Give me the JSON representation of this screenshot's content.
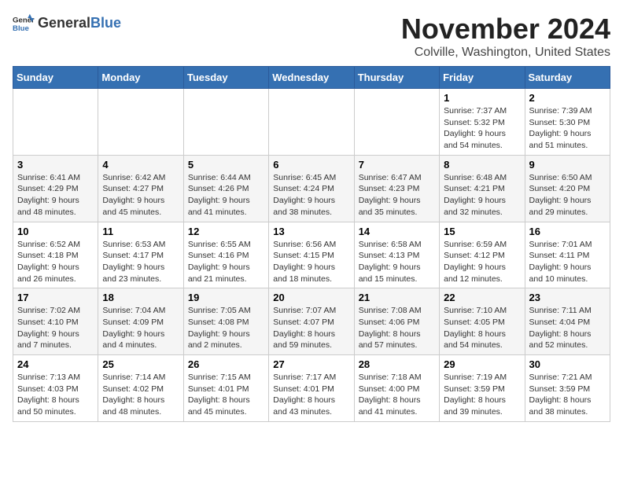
{
  "header": {
    "logo_general": "General",
    "logo_blue": "Blue",
    "month_title": "November 2024",
    "location": "Colville, Washington, United States"
  },
  "weekdays": [
    "Sunday",
    "Monday",
    "Tuesday",
    "Wednesday",
    "Thursday",
    "Friday",
    "Saturday"
  ],
  "weeks": [
    [
      {
        "day": "",
        "info": ""
      },
      {
        "day": "",
        "info": ""
      },
      {
        "day": "",
        "info": ""
      },
      {
        "day": "",
        "info": ""
      },
      {
        "day": "",
        "info": ""
      },
      {
        "day": "1",
        "info": "Sunrise: 7:37 AM\nSunset: 5:32 PM\nDaylight: 9 hours\nand 54 minutes."
      },
      {
        "day": "2",
        "info": "Sunrise: 7:39 AM\nSunset: 5:30 PM\nDaylight: 9 hours\nand 51 minutes."
      }
    ],
    [
      {
        "day": "3",
        "info": "Sunrise: 6:41 AM\nSunset: 4:29 PM\nDaylight: 9 hours\nand 48 minutes."
      },
      {
        "day": "4",
        "info": "Sunrise: 6:42 AM\nSunset: 4:27 PM\nDaylight: 9 hours\nand 45 minutes."
      },
      {
        "day": "5",
        "info": "Sunrise: 6:44 AM\nSunset: 4:26 PM\nDaylight: 9 hours\nand 41 minutes."
      },
      {
        "day": "6",
        "info": "Sunrise: 6:45 AM\nSunset: 4:24 PM\nDaylight: 9 hours\nand 38 minutes."
      },
      {
        "day": "7",
        "info": "Sunrise: 6:47 AM\nSunset: 4:23 PM\nDaylight: 9 hours\nand 35 minutes."
      },
      {
        "day": "8",
        "info": "Sunrise: 6:48 AM\nSunset: 4:21 PM\nDaylight: 9 hours\nand 32 minutes."
      },
      {
        "day": "9",
        "info": "Sunrise: 6:50 AM\nSunset: 4:20 PM\nDaylight: 9 hours\nand 29 minutes."
      }
    ],
    [
      {
        "day": "10",
        "info": "Sunrise: 6:52 AM\nSunset: 4:18 PM\nDaylight: 9 hours\nand 26 minutes."
      },
      {
        "day": "11",
        "info": "Sunrise: 6:53 AM\nSunset: 4:17 PM\nDaylight: 9 hours\nand 23 minutes."
      },
      {
        "day": "12",
        "info": "Sunrise: 6:55 AM\nSunset: 4:16 PM\nDaylight: 9 hours\nand 21 minutes."
      },
      {
        "day": "13",
        "info": "Sunrise: 6:56 AM\nSunset: 4:15 PM\nDaylight: 9 hours\nand 18 minutes."
      },
      {
        "day": "14",
        "info": "Sunrise: 6:58 AM\nSunset: 4:13 PM\nDaylight: 9 hours\nand 15 minutes."
      },
      {
        "day": "15",
        "info": "Sunrise: 6:59 AM\nSunset: 4:12 PM\nDaylight: 9 hours\nand 12 minutes."
      },
      {
        "day": "16",
        "info": "Sunrise: 7:01 AM\nSunset: 4:11 PM\nDaylight: 9 hours\nand 10 minutes."
      }
    ],
    [
      {
        "day": "17",
        "info": "Sunrise: 7:02 AM\nSunset: 4:10 PM\nDaylight: 9 hours\nand 7 minutes."
      },
      {
        "day": "18",
        "info": "Sunrise: 7:04 AM\nSunset: 4:09 PM\nDaylight: 9 hours\nand 4 minutes."
      },
      {
        "day": "19",
        "info": "Sunrise: 7:05 AM\nSunset: 4:08 PM\nDaylight: 9 hours\nand 2 minutes."
      },
      {
        "day": "20",
        "info": "Sunrise: 7:07 AM\nSunset: 4:07 PM\nDaylight: 8 hours\nand 59 minutes."
      },
      {
        "day": "21",
        "info": "Sunrise: 7:08 AM\nSunset: 4:06 PM\nDaylight: 8 hours\nand 57 minutes."
      },
      {
        "day": "22",
        "info": "Sunrise: 7:10 AM\nSunset: 4:05 PM\nDaylight: 8 hours\nand 54 minutes."
      },
      {
        "day": "23",
        "info": "Sunrise: 7:11 AM\nSunset: 4:04 PM\nDaylight: 8 hours\nand 52 minutes."
      }
    ],
    [
      {
        "day": "24",
        "info": "Sunrise: 7:13 AM\nSunset: 4:03 PM\nDaylight: 8 hours\nand 50 minutes."
      },
      {
        "day": "25",
        "info": "Sunrise: 7:14 AM\nSunset: 4:02 PM\nDaylight: 8 hours\nand 48 minutes."
      },
      {
        "day": "26",
        "info": "Sunrise: 7:15 AM\nSunset: 4:01 PM\nDaylight: 8 hours\nand 45 minutes."
      },
      {
        "day": "27",
        "info": "Sunrise: 7:17 AM\nSunset: 4:01 PM\nDaylight: 8 hours\nand 43 minutes."
      },
      {
        "day": "28",
        "info": "Sunrise: 7:18 AM\nSunset: 4:00 PM\nDaylight: 8 hours\nand 41 minutes."
      },
      {
        "day": "29",
        "info": "Sunrise: 7:19 AM\nSunset: 3:59 PM\nDaylight: 8 hours\nand 39 minutes."
      },
      {
        "day": "30",
        "info": "Sunrise: 7:21 AM\nSunset: 3:59 PM\nDaylight: 8 hours\nand 38 minutes."
      }
    ]
  ]
}
